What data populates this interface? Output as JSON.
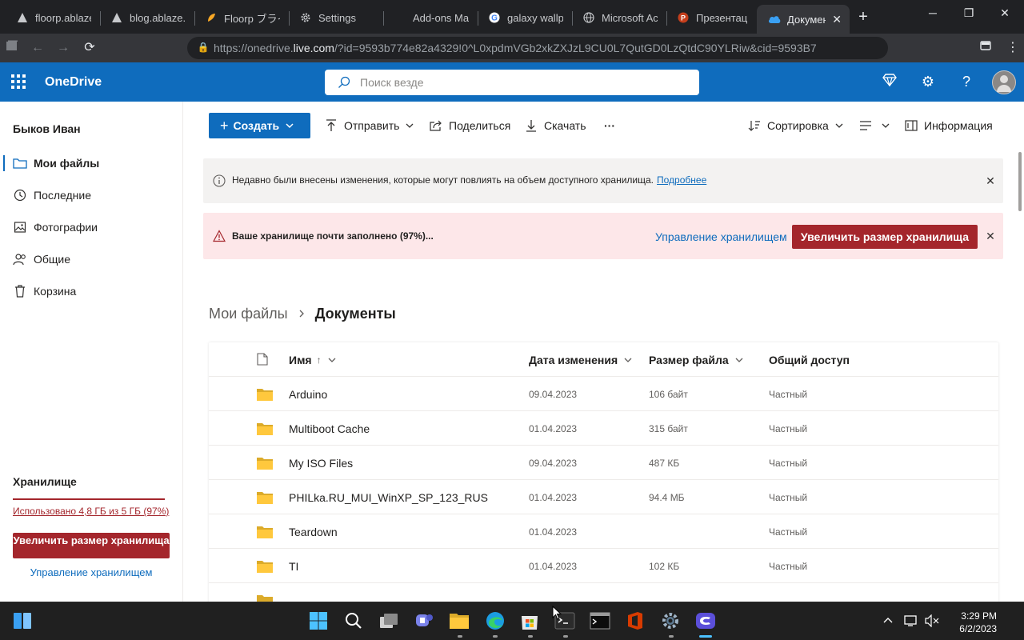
{
  "browser": {
    "tabs": [
      {
        "title": "floorp.ablaze",
        "icon": "warning-icon"
      },
      {
        "title": "blog.ablaze.o",
        "icon": "warning-icon"
      },
      {
        "title": "Floorp ブライ",
        "icon": "floorp-icon"
      },
      {
        "title": "Settings",
        "icon": "gear-icon"
      },
      {
        "title": "Add-ons Mana",
        "icon": "addons-icon"
      },
      {
        "title": "galaxy wallpa",
        "icon": "google-icon"
      },
      {
        "title": "Microsoft Act",
        "icon": "globe-icon"
      },
      {
        "title": "Презентация",
        "icon": "powerpoint-icon"
      },
      {
        "title": "Документы",
        "icon": "onedrive-icon",
        "active": true
      }
    ],
    "url_prefix": "https://onedrive.",
    "url_domain": "live.com",
    "url_rest": "/?id=9593b774e82a4329!0^L0xpdmVGb2xkZXJzL9CU0L7QutGD0LzQtdC90YLRiw&cid=9593B7"
  },
  "app": {
    "title": "OneDrive",
    "search_placeholder": "Поиск везде",
    "accent": "#0f6cbd",
    "danger": "#a4262c"
  },
  "nav": {
    "user": "Быков Иван",
    "items": [
      {
        "label": "Мои файлы",
        "icon": "folder-icon",
        "active": true
      },
      {
        "label": "Последние",
        "icon": "clock-icon"
      },
      {
        "label": "Фотографии",
        "icon": "image-icon"
      },
      {
        "label": "Общие",
        "icon": "people-icon"
      },
      {
        "label": "Корзина",
        "icon": "trash-icon"
      }
    ],
    "storage_title": "Хранилище",
    "storage_used": "Использовано 4,8 ГБ из 5 ГБ (97%)",
    "storage_percent": 97,
    "storage_button": "Увеличить размер хранилища",
    "storage_manage": "Управление хранилищем"
  },
  "commands": {
    "create": "Создать",
    "upload": "Отправить",
    "share": "Поделиться",
    "download": "Скачать",
    "more": "···",
    "sort": "Сортировка",
    "info": "Информация"
  },
  "banners": {
    "info_text": "Недавно были внесены изменения, которые могут повлиять на объем доступного хранилища.",
    "info_link": "Подробнее",
    "warn_text": "Ваше хранилище почти заполнено (97%)...",
    "warn_manage": "Управление хранилищем",
    "warn_button": "Увеличить размер хранилища"
  },
  "breadcrumb": {
    "parent": "Мои файлы",
    "current": "Документы"
  },
  "files": {
    "columns": {
      "name": "Имя",
      "modified": "Дата изменения",
      "size": "Размер файла",
      "sharing": "Общий доступ"
    },
    "rows": [
      {
        "name": "Arduino",
        "date": "09.04.2023",
        "size": "106 байт",
        "sharing": "Частный"
      },
      {
        "name": "Multiboot Cache",
        "date": "01.04.2023",
        "size": "315 байт",
        "sharing": "Частный"
      },
      {
        "name": "My ISO Files",
        "date": "09.04.2023",
        "size": "487 КБ",
        "sharing": "Частный"
      },
      {
        "name": "PHILka.RU_MUI_WinXP_SP_123_RUS",
        "date": "01.04.2023",
        "size": "94.4 МБ",
        "sharing": "Частный"
      },
      {
        "name": "Teardown",
        "date": "01.04.2023",
        "size": "",
        "sharing": "Частный"
      },
      {
        "name": "TI",
        "date": "01.04.2023",
        "size": "102 КБ",
        "sharing": "Частный"
      }
    ]
  },
  "taskbar": {
    "time": "3:29 PM",
    "date": "6/2/2023"
  }
}
